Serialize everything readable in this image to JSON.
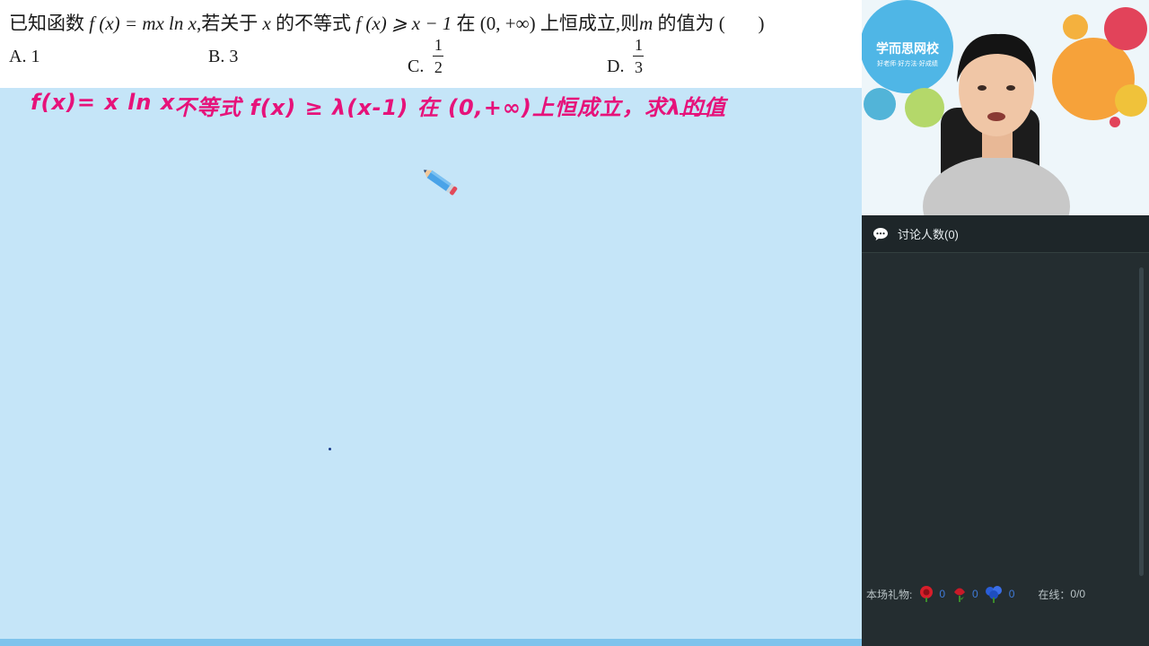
{
  "question": {
    "prefix": "已知函数",
    "func": "f (x) = mx ln x",
    "mid": ",若关于",
    "var": "x",
    "mid2": "的不等式",
    "ineq": "f (x) ⩾ x − 1",
    "mid3": "在",
    "interval": "(0, +∞)",
    "mid4": "上恒成立,则",
    "m": "m",
    "suffix": "的值为 (",
    "close": ")",
    "options": [
      {
        "label": "A. 1"
      },
      {
        "label": "B. 3"
      },
      {
        "label": "C.",
        "num": "1",
        "den": "2"
      },
      {
        "label": "D.",
        "num": "1",
        "den": "3"
      }
    ]
  },
  "annotations": {
    "line1": "f(x)= x ln x",
    "line2": "不等式 f(x) ≥ λ(x-1) 在 (0,+∞)上恒成立，求λ的值"
  },
  "video": {
    "logo_text": "学而思网校",
    "logo_sub": "好老师·好方法·好成绩"
  },
  "chat": {
    "title": "讨论人数(0)",
    "gifts_label": "本场礼物:",
    "gifts": [
      {
        "icon": "red-flower-icon",
        "count": "0"
      },
      {
        "icon": "red-rose-icon",
        "count": "0"
      },
      {
        "icon": "blue-flower-icon",
        "count": "0"
      }
    ],
    "online_label": "在线：",
    "online_value": "0/0"
  },
  "colors": {
    "board": "#c5e5f8",
    "handwriting": "#e6127a",
    "panel": "#242d30"
  }
}
